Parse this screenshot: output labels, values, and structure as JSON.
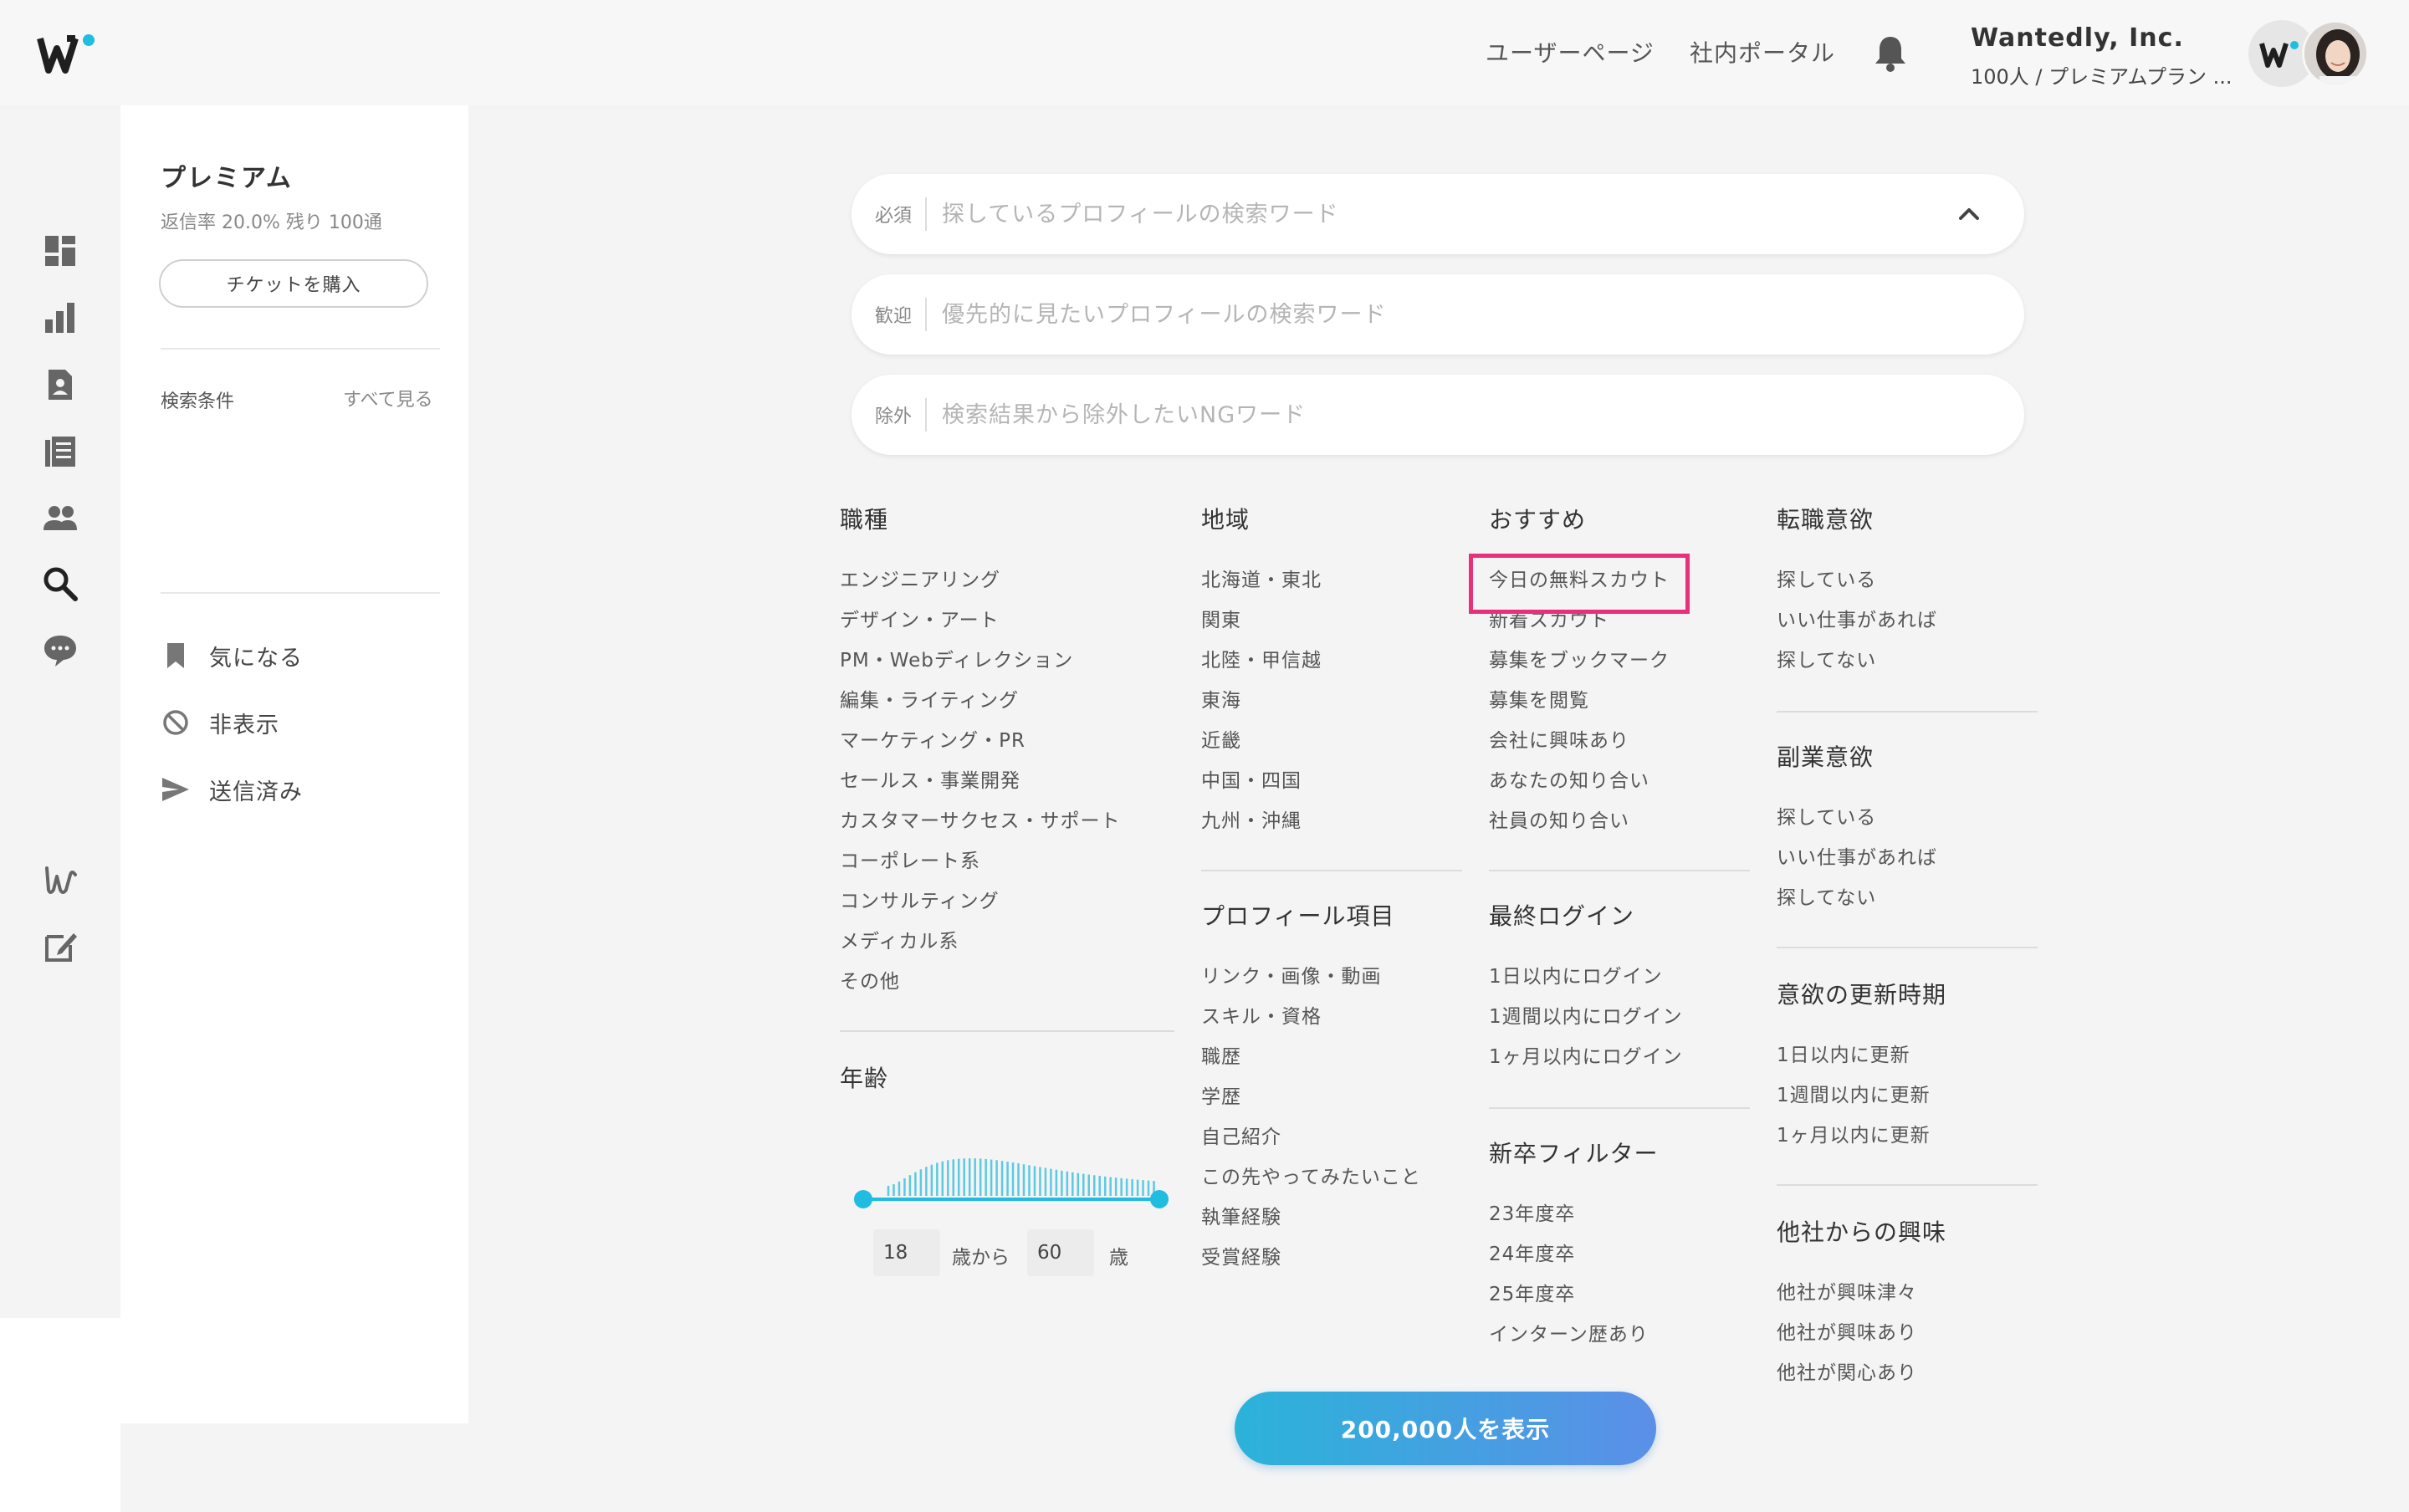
{
  "header": {
    "nav": [
      "ユーザーページ",
      "社内ポータル"
    ],
    "company_name": "Wantedly, Inc.",
    "company_plan": "100人 / プレミアムプラン ...",
    "accent_color": "#21bde0"
  },
  "rail": {
    "icons": [
      "dashboard-icon",
      "analytics-icon",
      "profile-card-icon",
      "list-icon",
      "people-icon",
      "search-icon",
      "chat-icon",
      "wantedly-icon",
      "edit-icon"
    ],
    "active": "search-icon"
  },
  "sidebar": {
    "plan_title": "プレミアム",
    "plan_stats": "返信率 20.0%  残り 100通",
    "ticket_button": "チケットを購入",
    "conditions_label": "検索条件",
    "see_all": "すべて見る",
    "items": [
      {
        "label": "気になる",
        "icon": "bookmark-icon"
      },
      {
        "label": "非表示",
        "icon": "hidden-icon"
      },
      {
        "label": "送信済み",
        "icon": "send-icon"
      }
    ]
  },
  "search": {
    "required": {
      "tag": "必須",
      "placeholder": "探しているプロフィールの検索ワード"
    },
    "welcome": {
      "tag": "歓迎",
      "placeholder": "優先的に見たいプロフィールの検索ワード"
    },
    "exclude": {
      "tag": "除外",
      "placeholder": "検索結果から除外したいNGワード"
    }
  },
  "filters": {
    "job": {
      "title": "職種",
      "options": [
        "エンジニアリング",
        "デザイン・アート",
        "PM・Webディレクション",
        "編集・ライティング",
        "マーケティング・PR",
        "セールス・事業開発",
        "カスタマーサクセス・サポート",
        "コーポレート系",
        "コンサルティング",
        "メディカル系",
        "その他"
      ]
    },
    "age": {
      "title": "年齢",
      "from": "18",
      "from_suffix": "歳から",
      "to": "60",
      "to_suffix": "歳"
    },
    "region": {
      "title": "地域",
      "options": [
        "北海道・東北",
        "関東",
        "北陸・甲信越",
        "東海",
        "近畿",
        "中国・四国",
        "九州・沖縄"
      ]
    },
    "profile": {
      "title": "プロフィール項目",
      "options": [
        "リンク・画像・動画",
        "スキル・資格",
        "職歴",
        "学歴",
        "自己紹介",
        "この先やってみたいこと",
        "執筆経験",
        "受賞経験"
      ]
    },
    "recommend": {
      "title": "おすすめ",
      "options": [
        "今日の無料スカウト",
        "新着スカウト",
        "募集をブックマーク",
        "募集を閲覧",
        "会社に興味あり",
        "あなたの知り合い",
        "社員の知り合い"
      ],
      "highlighted": "今日の無料スカウト"
    },
    "login": {
      "title": "最終ログイン",
      "options": [
        "1日以内にログイン",
        "1週間以内にログイン",
        "1ヶ月以内にログイン"
      ]
    },
    "newgrad": {
      "title": "新卒フィルター",
      "options": [
        "23年度卒",
        "24年度卒",
        "25年度卒",
        "インターン歴あり"
      ]
    },
    "job_change": {
      "title": "転職意欲",
      "options": [
        "探している",
        "いい仕事があれば",
        "探してない"
      ]
    },
    "side_job": {
      "title": "副業意欲",
      "options": [
        "探している",
        "いい仕事があれば",
        "探してない"
      ]
    },
    "update": {
      "title": "意欲の更新時期",
      "options": [
        "1日以内に更新",
        "1週間以内に更新",
        "1ヶ月以内に更新"
      ]
    },
    "interest": {
      "title": "他社からの興味",
      "options": [
        "他社が興味津々",
        "他社が興味あり",
        "他社が関心あり"
      ]
    }
  },
  "show_button": "200,000人を表示",
  "highlight_color": "#e8307a"
}
